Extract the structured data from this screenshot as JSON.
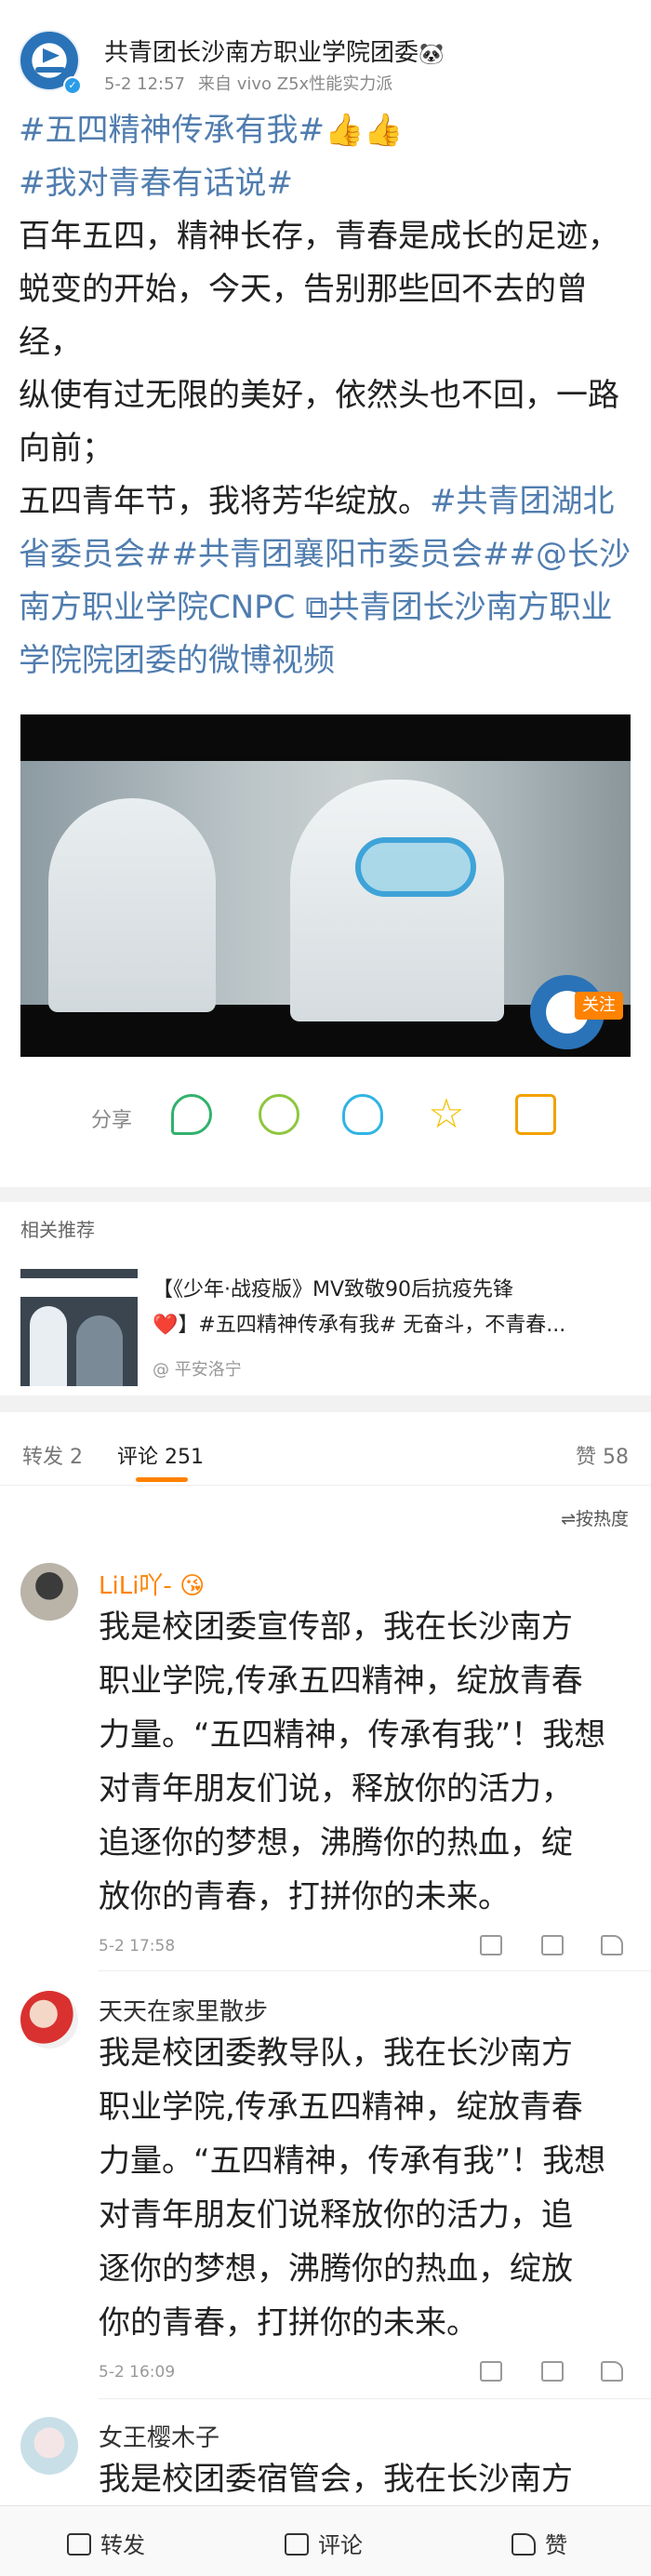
{
  "post": {
    "author": "共青团长沙南方职业学院团委",
    "author_emoji": "🐼",
    "time": "5-2 12:57",
    "source": "来自 vivo Z5x性能实力派",
    "line1_tag": "#五四精神传承有我#",
    "line1_emoji": "👍👍",
    "line2_tag": "#我对青春有话说#",
    "text_a": "百年五四，精神长存，青春是成长的足迹，蜕变的开始，今天，告别那些回不去的曾经，",
    "text_b": "纵使有过无限的美好，依然头也不回，一路向前；",
    "text_c": "五四青年节，我将芳华绽放。",
    "tag_hubei": "#共青团湖北省委员会#",
    "tag_xiangyang": "#共青团襄阳市委员会#",
    "mention": "#@长沙南方职业学院CNPC",
    "video_link": " ⧉共青团长沙南方职业学院院团委的微博视频"
  },
  "video": {
    "follow_label": "关注"
  },
  "share": {
    "label": "分享",
    "icons": [
      "wechat-icon",
      "moments-icon",
      "qq-icon",
      "favorite-star-icon",
      "save-image-icon"
    ]
  },
  "related": {
    "title": "相关推荐",
    "text_line1": "【《少年·战疫版》MV致敬90后抗疫先锋",
    "text_line2": "❤️】#五四精神传承有我# 无奋斗，不青春...",
    "source": "@ 平安洛宁"
  },
  "tabs": {
    "repost": "转发 2",
    "comments": "评论 251",
    "likes": "赞 58"
  },
  "sort": {
    "label": "⇌按热度"
  },
  "comments": [
    {
      "name": "LiLi吖-",
      "name_emoji": "😘",
      "lines": [
        "我是校团委宣传部，我在长沙南方",
        "职业学院,传承五四精神，绽放青春",
        "力量。“五四精神，传承有我”！我想",
        "对青年朋友们说，释放你的活力，",
        "追逐你的梦想，沸腾你的热血，绽",
        "放你的青春，打拼你的未来。"
      ],
      "time": "5-2 17:58"
    },
    {
      "name": "天天在家里散步",
      "lines": [
        "我是校团委教导队，我在长沙南方",
        "职业学院,传承五四精神，绽放青春",
        "力量。“五四精神，传承有我”！我想",
        "对青年朋友们说释放你的活力，追",
        "逐你的梦想，沸腾你的热血，绽放",
        "你的青春，打拼你的未来。"
      ],
      "time": "5-2 16:09"
    },
    {
      "name": "女王樱木子",
      "lines": [
        "我是校团委宿管会，我在长沙南方"
      ]
    }
  ],
  "bottom": {
    "repost": "转发",
    "comment": "评论",
    "like": "赞"
  },
  "colors": {
    "link": "#507daf",
    "accent": "#ff8200",
    "name_orange": "#ff8200",
    "name_default": "#333333"
  }
}
